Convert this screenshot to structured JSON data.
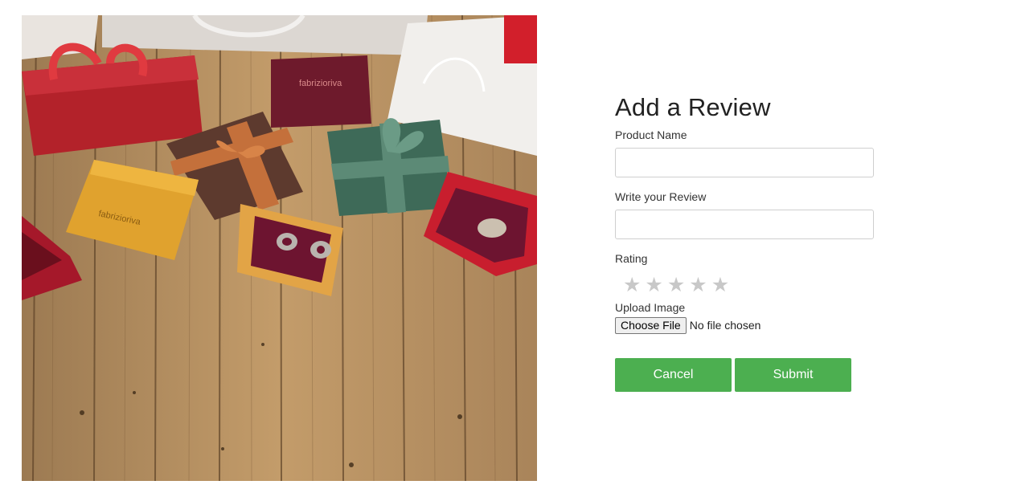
{
  "form": {
    "title": "Add a Review",
    "product_name_label": "Product Name",
    "product_name_value": "",
    "review_label": "Write your Review",
    "review_value": "",
    "rating_label": "Rating",
    "rating_value": 0,
    "rating_max": 5,
    "star_glyph": "★",
    "upload_label": "Upload Image",
    "choose_file_label": "Choose File",
    "file_status": "No file chosen",
    "cancel_label": "Cancel",
    "submit_label": "Submit"
  },
  "photo": {
    "box_brand_text": "fabriziorivа"
  },
  "colors": {
    "button_green": "#4caf50",
    "star_empty": "#c8c8c8"
  }
}
